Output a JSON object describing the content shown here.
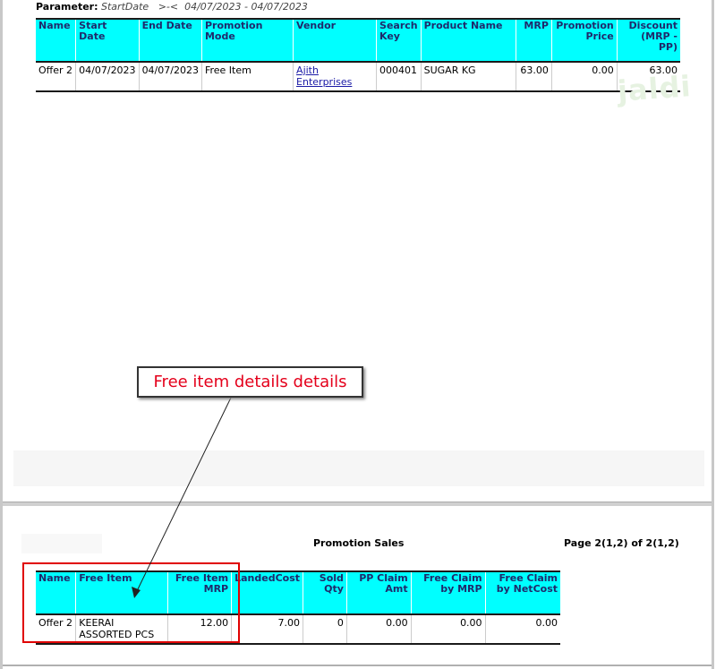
{
  "parameter": {
    "label": "Parameter:",
    "field": "StartDate",
    "operator": ">-<",
    "value": "04/07/2023 - 04/07/2023"
  },
  "top_table": {
    "headers": [
      "Name",
      "Start Date",
      "End Date",
      "Promotion Mode",
      "Vendor",
      "Search Key",
      "Product Name",
      "MRP",
      "Promotion Price",
      "Discount (MRP - PP)"
    ],
    "rows": [
      {
        "name": "Offer 2",
        "start_date": "04/07/2023",
        "end_date": "04/07/2023",
        "promotion_mode": "Free Item",
        "vendor": "Ajith Enterprises",
        "search_key": "000401",
        "product_name": "SUGAR KG",
        "mrp": "63.00",
        "promotion_price": "0.00",
        "discount": "63.00"
      }
    ]
  },
  "watermark": "jaldi",
  "annotation": {
    "callout_text": "Free item details details",
    "colors": {
      "text": "#e4001b",
      "box": "#e00000"
    }
  },
  "page2": {
    "title": "Promotion Sales",
    "page_info": "Page 2(1,2) of 2(1,2)"
  },
  "bottom_table": {
    "headers": [
      "Name",
      "Free Item",
      "Free Item MRP",
      "LandedCost",
      "Sold Qty",
      "PP Claim Amt",
      "Free Claim by MRP",
      "Free Claim by NetCost"
    ],
    "rows": [
      {
        "name": "Offer 2",
        "free_item": "KEERAI ASSORTED PCS",
        "free_item_mrp": "12.00",
        "landed_cost": "7.00",
        "sold_qty": "0",
        "pp_claim_amt": "0.00",
        "free_claim_mrp": "0.00",
        "free_claim_netcost": "0.00"
      }
    ]
  },
  "colors": {
    "header_bg": "#00ffff",
    "header_text": "#1f2a6b",
    "link": "#1a1aa6"
  }
}
